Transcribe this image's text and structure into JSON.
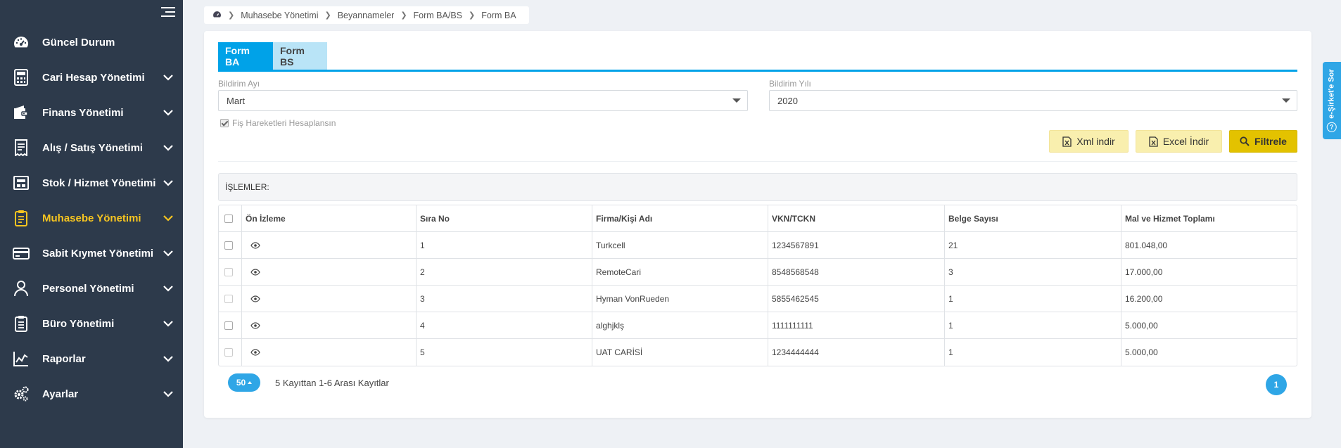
{
  "sidebar": {
    "items": [
      {
        "label": "Güncel Durum",
        "icon": "dashboard-icon"
      },
      {
        "label": "Cari Hesap Yönetimi",
        "icon": "calculator-icon"
      },
      {
        "label": "Finans Yönetimi",
        "icon": "wallet-icon"
      },
      {
        "label": "Alış / Satış Yönetimi",
        "icon": "receipt-icon"
      },
      {
        "label": "Stok / Hizmet Yönetimi",
        "icon": "box-icon"
      },
      {
        "label": "Muhasebe Yönetimi",
        "icon": "clipboard-icon",
        "active": true
      },
      {
        "label": "Sabit Kıymet Yönetimi",
        "icon": "credit-card-icon"
      },
      {
        "label": "Personel Yönetimi",
        "icon": "user-icon"
      },
      {
        "label": "Büro Yönetimi",
        "icon": "clipboard-list-icon"
      },
      {
        "label": "Raporlar",
        "icon": "chart-icon"
      },
      {
        "label": "Ayarlar",
        "icon": "gears-icon"
      }
    ]
  },
  "breadcrumb": {
    "home_icon": "dashboard-icon",
    "items": [
      "Muhasebe Yönetimi",
      "Beyannameler",
      "Form BA/BS",
      "Form BA"
    ]
  },
  "tabs": [
    {
      "label": "Form BA",
      "active": true
    },
    {
      "label": "Form BS",
      "active": false
    }
  ],
  "filters": {
    "month_label": "Bildirim Ayı",
    "month_value": "Mart",
    "year_label": "Bildirim Yılı",
    "year_value": "2020",
    "checkbox_label": "Fiş Hareketleri Hesaplansın",
    "checkbox_checked": true
  },
  "buttons": {
    "xml": "Xml indir",
    "excel": "Excel İndir",
    "filter": "Filtrele"
  },
  "section_title": "İŞLEMLER:",
  "table": {
    "headers": [
      "Ön İzleme",
      "Sıra No",
      "Firma/Kişi Adı",
      "VKN/TCKN",
      "Belge Sayısı",
      "Mal ve Hizmet Toplamı"
    ],
    "rows": [
      {
        "sira": "1",
        "firma": "Turkcell",
        "vkn": "1234567891",
        "belge": "21",
        "toplam": "801.048,00"
      },
      {
        "sira": "2",
        "firma": "RemoteCari",
        "vkn": "8548568548",
        "belge": "3",
        "toplam": "17.000,00"
      },
      {
        "sira": "3",
        "firma": "Hyman VonRueden",
        "vkn": "5855462545",
        "belge": "1",
        "toplam": "16.200,00"
      },
      {
        "sira": "4",
        "firma": "alghjklş",
        "vkn": "1111111111",
        "belge": "1",
        "toplam": "5.000,00"
      },
      {
        "sira": "5",
        "firma": "UAT CARİSİ",
        "vkn": "1234444444",
        "belge": "1",
        "toplam": "5.000,00"
      }
    ]
  },
  "pagination": {
    "per_page": "50",
    "info": "5 Kayıttan 1-6 Arası Kayıtlar",
    "current_page": "1"
  },
  "side_tab": {
    "label": "e-Şirket'e Sor"
  },
  "colors": {
    "sidebar_bg": "#2d3a4b",
    "active_nav": "#f7c520",
    "accent_blue": "#00a2e8",
    "filter_button": "#e3c200",
    "light_button": "#f9efae"
  }
}
